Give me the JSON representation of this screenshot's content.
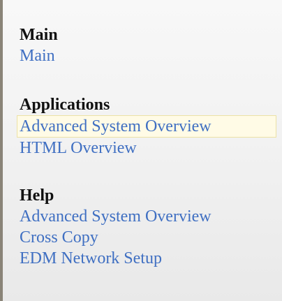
{
  "sections": {
    "main": {
      "heading": "Main",
      "links": [
        "Main"
      ]
    },
    "applications": {
      "heading": "Applications",
      "links": [
        "Advanced System Overview",
        "HTML Overview"
      ]
    },
    "help": {
      "heading": "Help",
      "links": [
        "Advanced System Overview",
        "Cross Copy",
        "EDM Network Setup"
      ]
    }
  },
  "colors": {
    "link": "#3f6fc2",
    "heading": "#111111",
    "highlight_background": "#fffbe6",
    "highlight_border": "#ece2a6",
    "left_border": "#8a8478"
  }
}
